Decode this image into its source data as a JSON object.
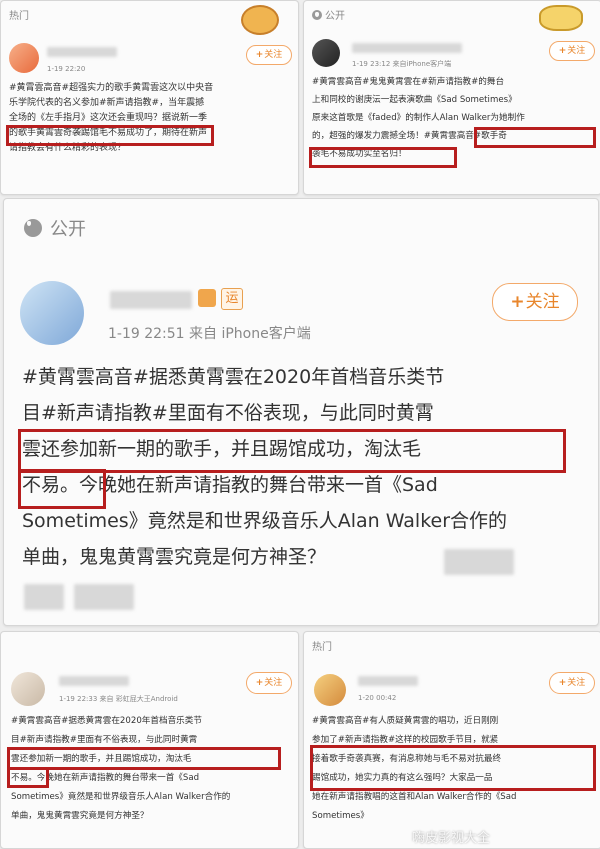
{
  "common": {
    "follow": "关注",
    "plus": "+"
  },
  "card1": {
    "header": "热门",
    "meta": "1-19 22:20",
    "text": [
      "#黄霄雲高音#超强实力的歌手黄霄雲这次以中央音",
      "乐学院代表的名义参加#新声请指教#，当年震撼",
      "全场的《左手指月》这次还会重现吗？据说新一季",
      "的歌手黄霄雲奇袭踢馆毛不易成功了，期待在新声",
      "请指教会有什么精彩的表现？"
    ]
  },
  "card2": {
    "header": "公开",
    "meta": "1-19 23:12 来自iPhone客户端",
    "text": [
      "#黄霄雲高音#鬼鬼黄霄雲在#新声请指教#的舞台",
      "上和同校的谢庚沄一起表演歌曲《Sad Sometimes》",
      "原来这首歌是《faded》的制作人Alan Walker为她制作",
      "的，超强的爆发力震撼全场！#黄霄雲高音#歌手奇",
      "袭毛不易成功实至名归！"
    ]
  },
  "card3": {
    "header": "公开",
    "badge": "运",
    "meta": "1-19 22:51  来自 iPhone客户端",
    "text": [
      "#黄霄雲高音#据悉黄霄雲在2020年首档音乐类节",
      "目#新声请指教#里面有不俗表现，与此同时黄霄",
      "雲还参加新一期的歌手，并且踢馆成功，淘汰毛",
      "不易。今晚她在新声请指教的舞台带来一首《Sad",
      "Sometimes》竟然是和世界级音乐人Alan Walker合作的",
      "单曲，鬼鬼黄霄雲究竟是何方神圣？"
    ]
  },
  "card4": {
    "meta": "1-19 22:33 来自 彩虹屁大王Android",
    "text": [
      "#黄霄雲高音#据悉黄霄雲在2020年首档音乐类节",
      "目#新声请指教#里面有不俗表现，与此同时黄霄",
      "雲还参加新一期的歌手，并且踢馆成功，淘汰毛",
      "不易。今晚她在新声请指教的舞台带来一首《Sad",
      "Sometimes》竟然是和世界级音乐人Alan Walker合作的",
      "单曲，鬼鬼黄霄雲究竟是何方神圣？"
    ]
  },
  "card5": {
    "header": "热门",
    "meta": "1-20 00:42",
    "text": [
      "#黄霄雲高音#有人质疑黄霄雲的唱功，近日刚刚",
      "参加了#新声请指教#这样的校园歌手节目，就紧",
      "接着歌手奇袭真赛，有消息称她与毛不易对抗最终",
      "踢馆成功，她实力真的有这么强吗？大家品一品",
      "她在新声请指教唱的这首和Alan Walker合作的《Sad",
      "Sometimes》"
    ],
    "watermark": "嗨皮影视大全"
  }
}
